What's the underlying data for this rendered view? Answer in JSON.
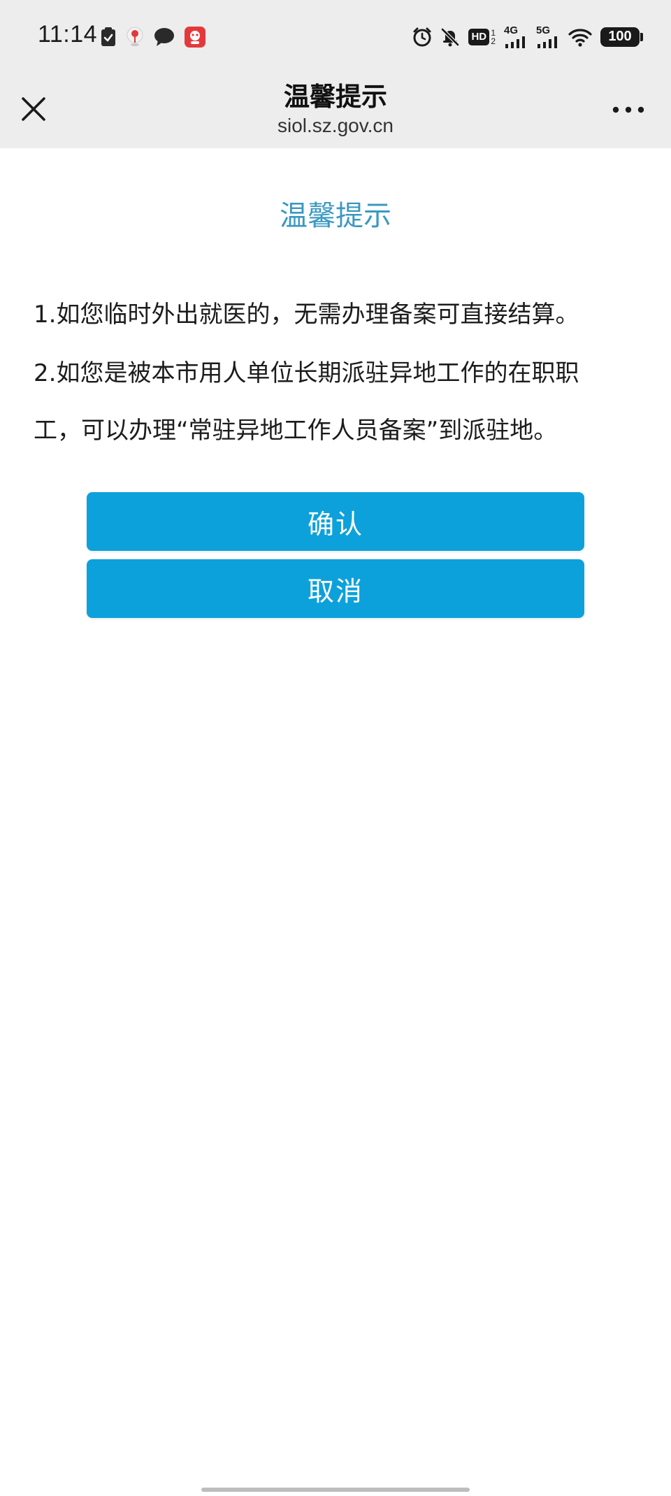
{
  "status_bar": {
    "time": "11:14",
    "left_icons": [
      "clipboard-check-icon",
      "map-pin-icon",
      "chat-bubble-icon",
      "app-notification-icon"
    ],
    "right_icons": [
      "alarm-icon",
      "bell-muted-icon",
      "hd-icon",
      "signal-icon",
      "signal-icon",
      "wifi-icon",
      "battery-icon"
    ],
    "hd_label": "HD",
    "hd_sub_top": "1",
    "hd_sub_bottom": "2",
    "network_1": "4G",
    "network_2": "5G",
    "battery_level": "100"
  },
  "nav_bar": {
    "title": "温馨提示",
    "subtitle": "siol.sz.gov.cn",
    "close_icon": "close-icon",
    "more_icon": "more-icon"
  },
  "dialog": {
    "title": "温馨提示",
    "line_1": "1.如您临时外出就医的，无需办理备案可直接结算。",
    "line_2a": "2.如您是被本市用人单位长期派驻异地工作的在职职",
    "line_2b": "工，可以办理“常驻异地工作人员备案”到派驻地。",
    "confirm_label": "确认",
    "cancel_label": "取消"
  },
  "colors": {
    "accent_title": "#3a98c2",
    "button_bg": "#0da1db",
    "bar_bg": "#ededed"
  }
}
